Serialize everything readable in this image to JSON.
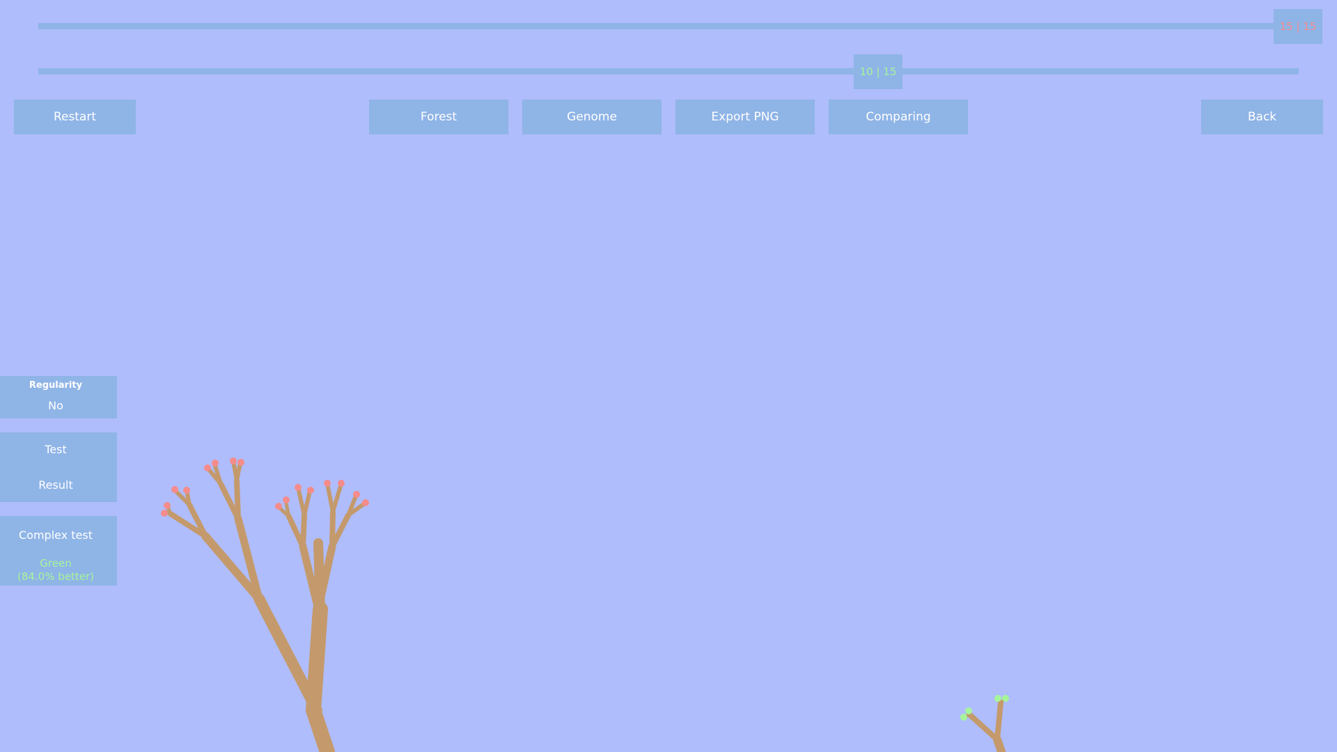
{
  "sliders": {
    "top": {
      "label": "15 | 15",
      "value": 1.0,
      "color": "#f48c8c"
    },
    "bottom": {
      "label": "10 | 15",
      "value": 0.667,
      "color": "#a6f59b"
    }
  },
  "toolbar": {
    "restart": "Restart",
    "forest": "Forest",
    "genome": "Genome",
    "export_png": "Export PNG",
    "comparing": "Comparing",
    "back": "Back"
  },
  "side_panel": {
    "regularity_title": "Regularity",
    "regularity_value": "No",
    "test_label": "Test",
    "result_label": "Result",
    "complex_test_label": "Complex test",
    "complex_result_line1": "Green",
    "complex_result_line2": "(84.0% better)",
    "complex_result_color": "#a6f59b"
  },
  "colors": {
    "background": "#afbdfc",
    "panel": "#8fb4e6",
    "branch": "#c49a6c",
    "leaf_red": "#f48c8c",
    "leaf_green": "#a6f59b"
  }
}
